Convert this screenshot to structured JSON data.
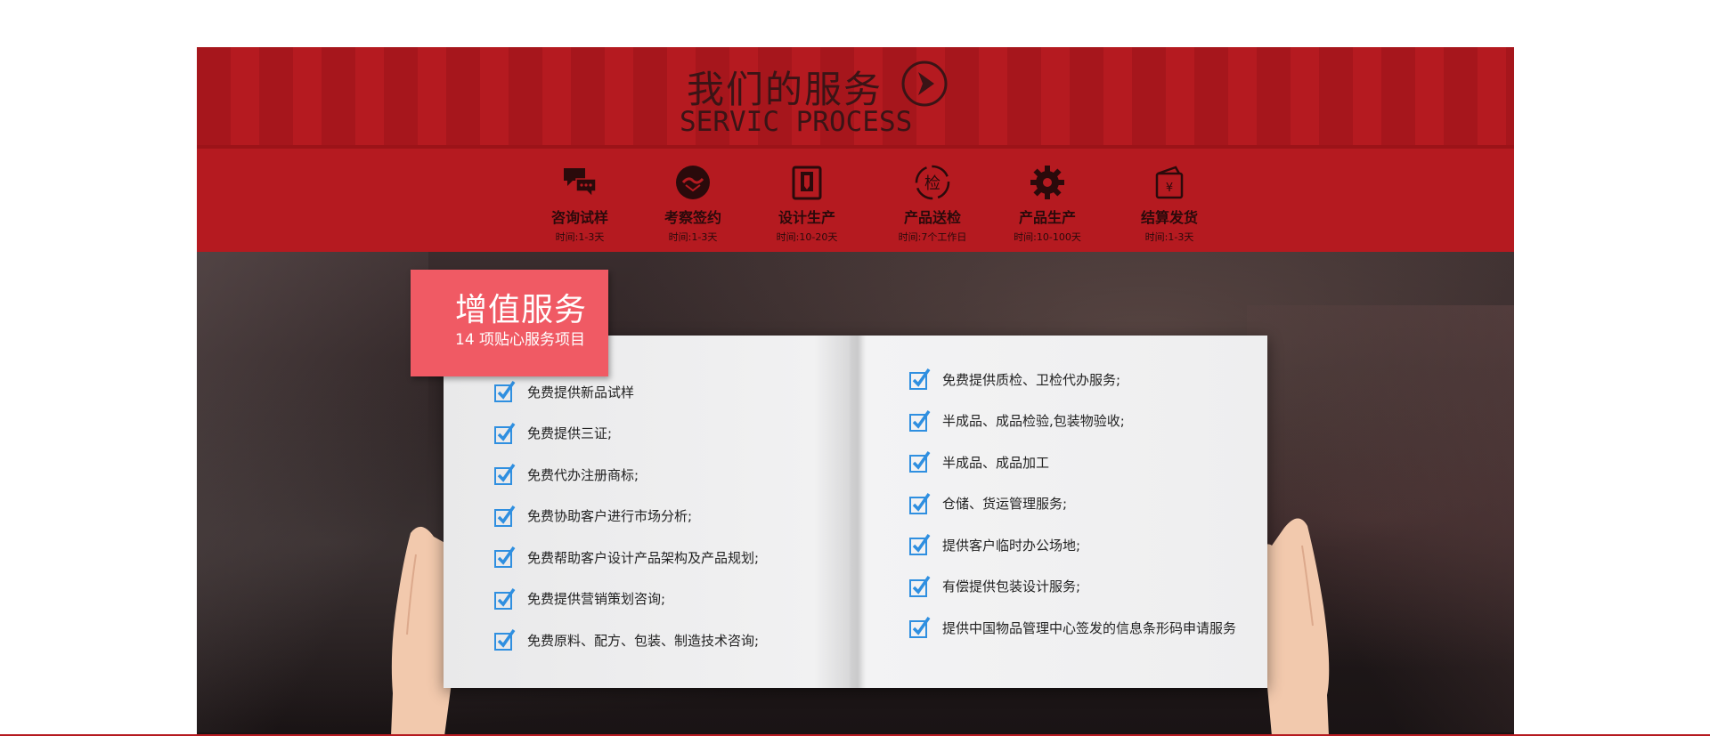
{
  "section": {
    "title_cn": "我们的服务",
    "title_en": "SERVIC PROCESS"
  },
  "steps": [
    {
      "name": "咨询试样",
      "time": "时间:1-3天",
      "icon": "chat-bubbles-icon"
    },
    {
      "name": "考察签约",
      "time": "时间:1-3天",
      "icon": "handshake-icon"
    },
    {
      "name": "设计生产",
      "time": "时间:10-20天",
      "icon": "design-icon"
    },
    {
      "name": "产品送检",
      "time": "时间:7个工作日",
      "icon": "inspection-icon"
    },
    {
      "name": "产品生产",
      "time": "时间:10-100天",
      "icon": "gear-icon"
    },
    {
      "name": "结算发货",
      "time": "时间:1-3天",
      "icon": "wallet-icon"
    }
  ],
  "value_added": {
    "title": "增值服务",
    "subtitle": "14 项贴心服务项目"
  },
  "left_items": [
    "免费提供新品试样",
    "免费提供三证;",
    "免费代办注册商标;",
    "免费协助客户进行市场分析;",
    "免费帮助客户设计产品架构及产品规划;",
    "免费提供营销策划咨询;",
    "免费原料、配方、包装、制造技术咨询;"
  ],
  "right_items": [
    "免费提供质检、卫检代办服务;",
    "半成品、成品检验,包装物验收;",
    "半成品、成品加工",
    "仓储、货运管理服务;",
    "提供客户临时办公场地;",
    "有偿提供包装设计服务;",
    "提供中国物品管理中心签发的信息条形码申请服务"
  ],
  "colors": {
    "brand_red": "#b51a20",
    "tag_pink": "#f05a64",
    "check_blue": "#2f8fe0"
  }
}
